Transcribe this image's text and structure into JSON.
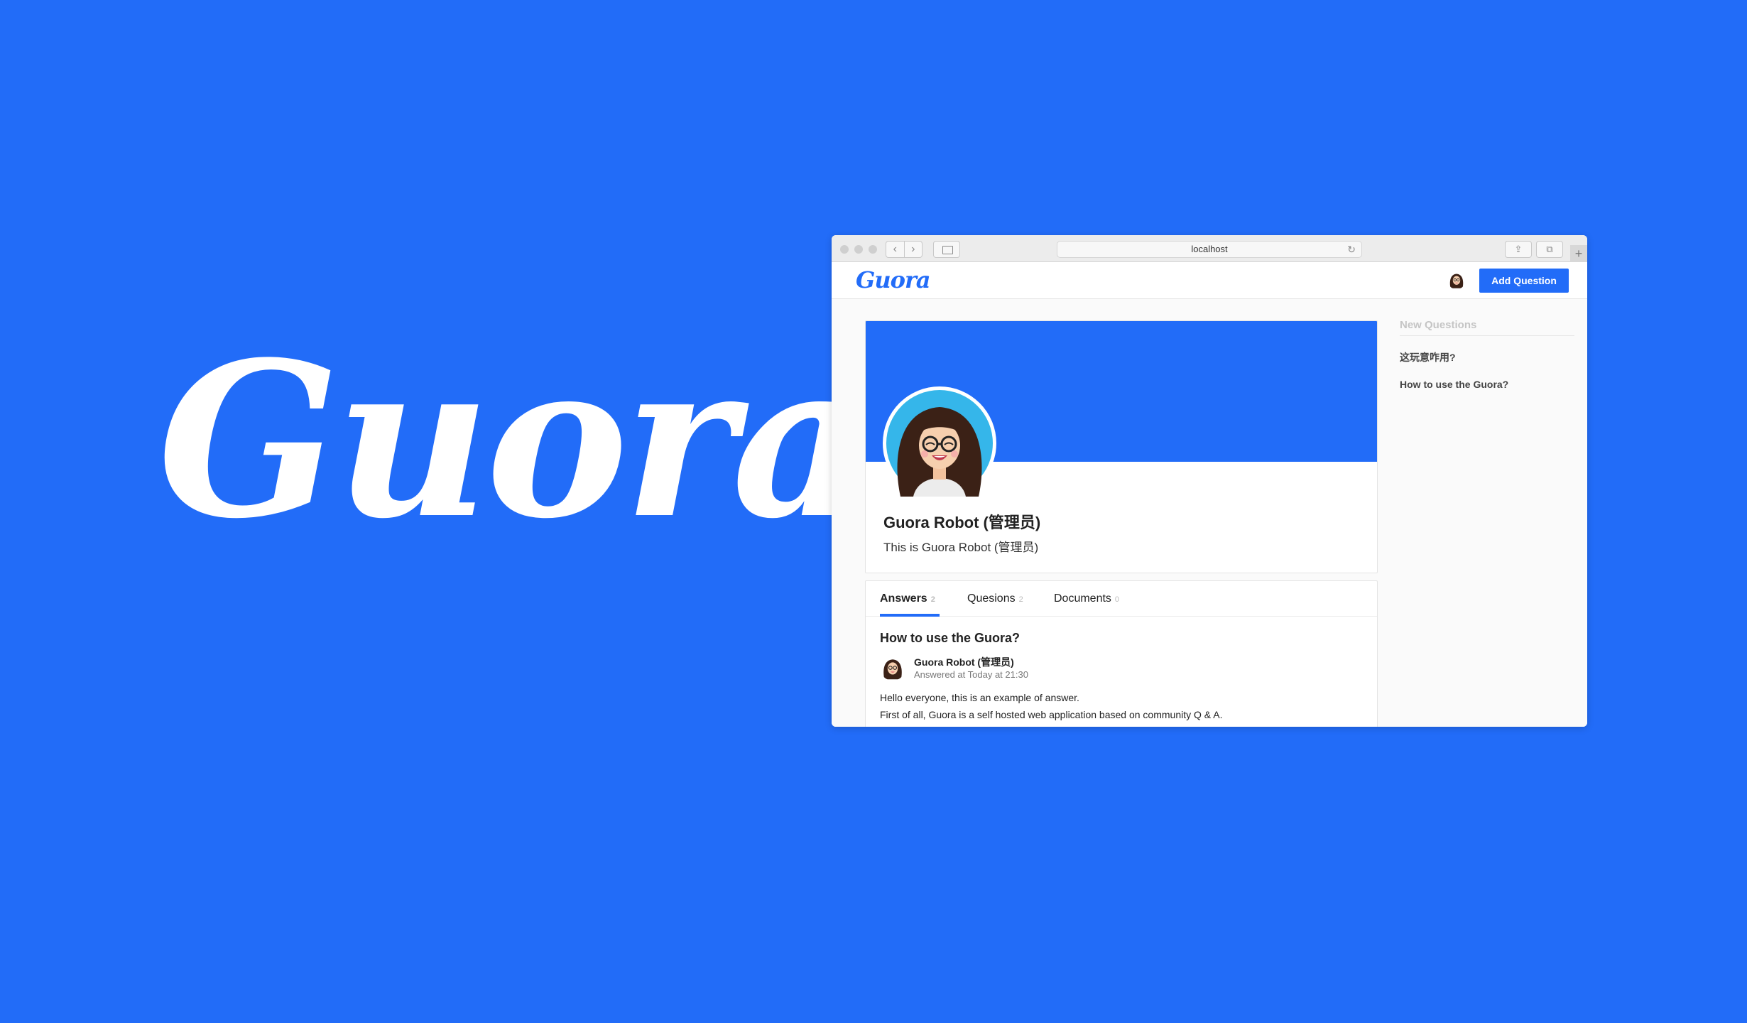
{
  "brand": {
    "logo_text": "Guora"
  },
  "browser": {
    "url": "localhost",
    "back_glyph": "‹",
    "forward_glyph": "›",
    "reload_glyph": "↻",
    "share_glyph": "⇪",
    "tabs_glyph": "⧉",
    "newtab_glyph": "+"
  },
  "header": {
    "logo_text": "Guora",
    "add_question_label": "Add Question"
  },
  "profile": {
    "name": "Guora Robot (管理员)",
    "bio": "This is Guora Robot (管理员)"
  },
  "tabs": [
    {
      "label": "Answers",
      "count": "2"
    },
    {
      "label": "Quesions",
      "count": "2"
    },
    {
      "label": "Documents",
      "count": "0"
    }
  ],
  "answer": {
    "title": "How to use the Guora?",
    "author": "Guora Robot (管理员)",
    "meta": "Answered at Today at 21:30",
    "line1": "Hello everyone, this is an example of answer.",
    "line2": "First of all, Guora is a self hosted web application based on community Q & A."
  },
  "sidebar": {
    "title": "New Questions",
    "items": [
      "这玩意咋用?",
      "How to use the Guora?"
    ]
  },
  "colors": {
    "brand": "#226cf8",
    "text": "#222222"
  }
}
